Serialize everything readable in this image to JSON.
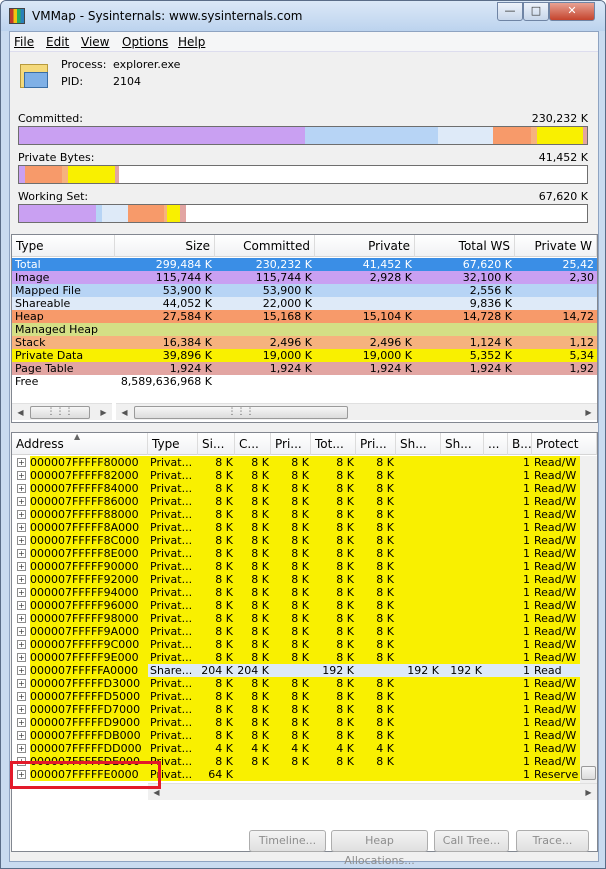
{
  "window": {
    "title": "VMMap - Sysinternals: www.sysinternals.com"
  },
  "menu": [
    "File",
    "Edit",
    "View",
    "Options",
    "Help"
  ],
  "process": {
    "process_label": "Process:",
    "process_name": "explorer.exe",
    "pid_label": "PID:",
    "pid": "2104"
  },
  "summary": {
    "committed_label": "Committed:",
    "committed_value": "230,232 K",
    "private_label": "Private Bytes:",
    "private_value": "41,452 K",
    "working_label": "Working Set:",
    "working_value": "67,620 K"
  },
  "colors": {
    "total": "#3a8ee6",
    "image": "#c9a0f2",
    "mapped": "#b7d4f5",
    "shareable": "#deeaf8",
    "heap": "#f79a6a",
    "managed": "#d4df85",
    "stack": "#f6b27e",
    "private": "#f9f000",
    "pagetable": "#e2a5a2",
    "free": "#ffffff",
    "selected": "#f9f000"
  },
  "type_table": {
    "columns": [
      "Type",
      "Size",
      "Committed",
      "Private",
      "Total WS",
      "Private W"
    ],
    "rows": [
      {
        "type": "Total",
        "size": "299,484 K",
        "committed": "230,232 K",
        "private": "41,452 K",
        "total_ws": "67,620 K",
        "private_ws": "25,42"
      },
      {
        "type": "Image",
        "size": "115,744 K",
        "committed": "115,744 K",
        "private": "2,928 K",
        "total_ws": "32,100 K",
        "private_ws": "2,30"
      },
      {
        "type": "Mapped File",
        "size": "53,900 K",
        "committed": "53,900 K",
        "private": "",
        "total_ws": "2,556 K",
        "private_ws": ""
      },
      {
        "type": "Shareable",
        "size": "44,052 K",
        "committed": "22,000 K",
        "private": "",
        "total_ws": "9,836 K",
        "private_ws": ""
      },
      {
        "type": "Heap",
        "size": "27,584 K",
        "committed": "15,168 K",
        "private": "15,104 K",
        "total_ws": "14,728 K",
        "private_ws": "14,72"
      },
      {
        "type": "Managed Heap",
        "size": "",
        "committed": "",
        "private": "",
        "total_ws": "",
        "private_ws": ""
      },
      {
        "type": "Stack",
        "size": "16,384 K",
        "committed": "2,496 K",
        "private": "2,496 K",
        "total_ws": "1,124 K",
        "private_ws": "1,12"
      },
      {
        "type": "Private Data",
        "size": "39,896 K",
        "committed": "19,000 K",
        "private": "19,000 K",
        "total_ws": "5,352 K",
        "private_ws": "5,34"
      },
      {
        "type": "Page Table",
        "size": "1,924 K",
        "committed": "1,924 K",
        "private": "1,924 K",
        "total_ws": "1,924 K",
        "private_ws": "1,92"
      },
      {
        "type": "Free",
        "size": "8,589,636,968 K",
        "committed": "",
        "private": "",
        "total_ws": "",
        "private_ws": ""
      }
    ]
  },
  "address_table": {
    "columns": [
      "Address",
      "Type",
      "Si...",
      "C...",
      "Pri...",
      "Tot...",
      "Pri...",
      "Sh...",
      "Sh...",
      "...",
      "B...",
      "Protect"
    ],
    "rows": [
      {
        "addr": "000007FFFFF80000",
        "type": "Privat...",
        "size": "8 K",
        "com": "8 K",
        "priv": "8 K",
        "tot": "8 K",
        "pws": "8 K",
        "sh1": "",
        "sh2": "",
        "blk": "1",
        "prot": "Read/W"
      },
      {
        "addr": "000007FFFFF82000",
        "type": "Privat...",
        "size": "8 K",
        "com": "8 K",
        "priv": "8 K",
        "tot": "8 K",
        "pws": "8 K",
        "sh1": "",
        "sh2": "",
        "blk": "1",
        "prot": "Read/W"
      },
      {
        "addr": "000007FFFFF84000",
        "type": "Privat...",
        "size": "8 K",
        "com": "8 K",
        "priv": "8 K",
        "tot": "8 K",
        "pws": "8 K",
        "sh1": "",
        "sh2": "",
        "blk": "1",
        "prot": "Read/W"
      },
      {
        "addr": "000007FFFFF86000",
        "type": "Privat...",
        "size": "8 K",
        "com": "8 K",
        "priv": "8 K",
        "tot": "8 K",
        "pws": "8 K",
        "sh1": "",
        "sh2": "",
        "blk": "1",
        "prot": "Read/W"
      },
      {
        "addr": "000007FFFFF88000",
        "type": "Privat...",
        "size": "8 K",
        "com": "8 K",
        "priv": "8 K",
        "tot": "8 K",
        "pws": "8 K",
        "sh1": "",
        "sh2": "",
        "blk": "1",
        "prot": "Read/W"
      },
      {
        "addr": "000007FFFFF8A000",
        "type": "Privat...",
        "size": "8 K",
        "com": "8 K",
        "priv": "8 K",
        "tot": "8 K",
        "pws": "8 K",
        "sh1": "",
        "sh2": "",
        "blk": "1",
        "prot": "Read/W"
      },
      {
        "addr": "000007FFFFF8C000",
        "type": "Privat...",
        "size": "8 K",
        "com": "8 K",
        "priv": "8 K",
        "tot": "8 K",
        "pws": "8 K",
        "sh1": "",
        "sh2": "",
        "blk": "1",
        "prot": "Read/W"
      },
      {
        "addr": "000007FFFFF8E000",
        "type": "Privat...",
        "size": "8 K",
        "com": "8 K",
        "priv": "8 K",
        "tot": "8 K",
        "pws": "8 K",
        "sh1": "",
        "sh2": "",
        "blk": "1",
        "prot": "Read/W"
      },
      {
        "addr": "000007FFFFF90000",
        "type": "Privat...",
        "size": "8 K",
        "com": "8 K",
        "priv": "8 K",
        "tot": "8 K",
        "pws": "8 K",
        "sh1": "",
        "sh2": "",
        "blk": "1",
        "prot": "Read/W"
      },
      {
        "addr": "000007FFFFF92000",
        "type": "Privat...",
        "size": "8 K",
        "com": "8 K",
        "priv": "8 K",
        "tot": "8 K",
        "pws": "8 K",
        "sh1": "",
        "sh2": "",
        "blk": "1",
        "prot": "Read/W"
      },
      {
        "addr": "000007FFFFF94000",
        "type": "Privat...",
        "size": "8 K",
        "com": "8 K",
        "priv": "8 K",
        "tot": "8 K",
        "pws": "8 K",
        "sh1": "",
        "sh2": "",
        "blk": "1",
        "prot": "Read/W"
      },
      {
        "addr": "000007FFFFF96000",
        "type": "Privat...",
        "size": "8 K",
        "com": "8 K",
        "priv": "8 K",
        "tot": "8 K",
        "pws": "8 K",
        "sh1": "",
        "sh2": "",
        "blk": "1",
        "prot": "Read/W"
      },
      {
        "addr": "000007FFFFF98000",
        "type": "Privat...",
        "size": "8 K",
        "com": "8 K",
        "priv": "8 K",
        "tot": "8 K",
        "pws": "8 K",
        "sh1": "",
        "sh2": "",
        "blk": "1",
        "prot": "Read/W"
      },
      {
        "addr": "000007FFFFF9A000",
        "type": "Privat...",
        "size": "8 K",
        "com": "8 K",
        "priv": "8 K",
        "tot": "8 K",
        "pws": "8 K",
        "sh1": "",
        "sh2": "",
        "blk": "1",
        "prot": "Read/W"
      },
      {
        "addr": "000007FFFFF9C000",
        "type": "Privat...",
        "size": "8 K",
        "com": "8 K",
        "priv": "8 K",
        "tot": "8 K",
        "pws": "8 K",
        "sh1": "",
        "sh2": "",
        "blk": "1",
        "prot": "Read/W"
      },
      {
        "addr": "000007FFFFF9E000",
        "type": "Privat...",
        "size": "8 K",
        "com": "8 K",
        "priv": "8 K",
        "tot": "8 K",
        "pws": "8 K",
        "sh1": "",
        "sh2": "",
        "blk": "1",
        "prot": "Read/W"
      },
      {
        "addr": "000007FFFFFA0000",
        "type": "Share...",
        "size": "204 K",
        "com": "204 K",
        "priv": "",
        "tot": "192 K",
        "pws": "",
        "sh1": "192 K",
        "sh2": "192 K",
        "blk": "1",
        "prot": "Read"
      },
      {
        "addr": "000007FFFFFD3000",
        "type": "Privat...",
        "size": "8 K",
        "com": "8 K",
        "priv": "8 K",
        "tot": "8 K",
        "pws": "8 K",
        "sh1": "",
        "sh2": "",
        "blk": "1",
        "prot": "Read/W"
      },
      {
        "addr": "000007FFFFFD5000",
        "type": "Privat...",
        "size": "8 K",
        "com": "8 K",
        "priv": "8 K",
        "tot": "8 K",
        "pws": "8 K",
        "sh1": "",
        "sh2": "",
        "blk": "1",
        "prot": "Read/W"
      },
      {
        "addr": "000007FFFFFD7000",
        "type": "Privat...",
        "size": "8 K",
        "com": "8 K",
        "priv": "8 K",
        "tot": "8 K",
        "pws": "8 K",
        "sh1": "",
        "sh2": "",
        "blk": "1",
        "prot": "Read/W"
      },
      {
        "addr": "000007FFFFFD9000",
        "type": "Privat...",
        "size": "8 K",
        "com": "8 K",
        "priv": "8 K",
        "tot": "8 K",
        "pws": "8 K",
        "sh1": "",
        "sh2": "",
        "blk": "1",
        "prot": "Read/W"
      },
      {
        "addr": "000007FFFFFDB000",
        "type": "Privat...",
        "size": "8 K",
        "com": "8 K",
        "priv": "8 K",
        "tot": "8 K",
        "pws": "8 K",
        "sh1": "",
        "sh2": "",
        "blk": "1",
        "prot": "Read/W"
      },
      {
        "addr": "000007FFFFFDD000",
        "type": "Privat...",
        "size": "4 K",
        "com": "4 K",
        "priv": "4 K",
        "tot": "4 K",
        "pws": "4 K",
        "sh1": "",
        "sh2": "",
        "blk": "1",
        "prot": "Read/W"
      },
      {
        "addr": "000007FFFFFDE000",
        "type": "Privat...",
        "size": "8 K",
        "com": "8 K",
        "priv": "8 K",
        "tot": "8 K",
        "pws": "8 K",
        "sh1": "",
        "sh2": "",
        "blk": "1",
        "prot": "Read/W"
      },
      {
        "addr": "000007FFFFFE0000",
        "type": "Privat...",
        "size": "64 K",
        "com": "",
        "priv": "",
        "tot": "",
        "pws": "",
        "sh1": "",
        "sh2": "",
        "blk": "1",
        "prot": "Reserve"
      }
    ]
  },
  "buttons": {
    "timeline": "Timeline...",
    "heap": "Heap Allocations...",
    "calltree": "Call Tree...",
    "trace": "Trace..."
  }
}
